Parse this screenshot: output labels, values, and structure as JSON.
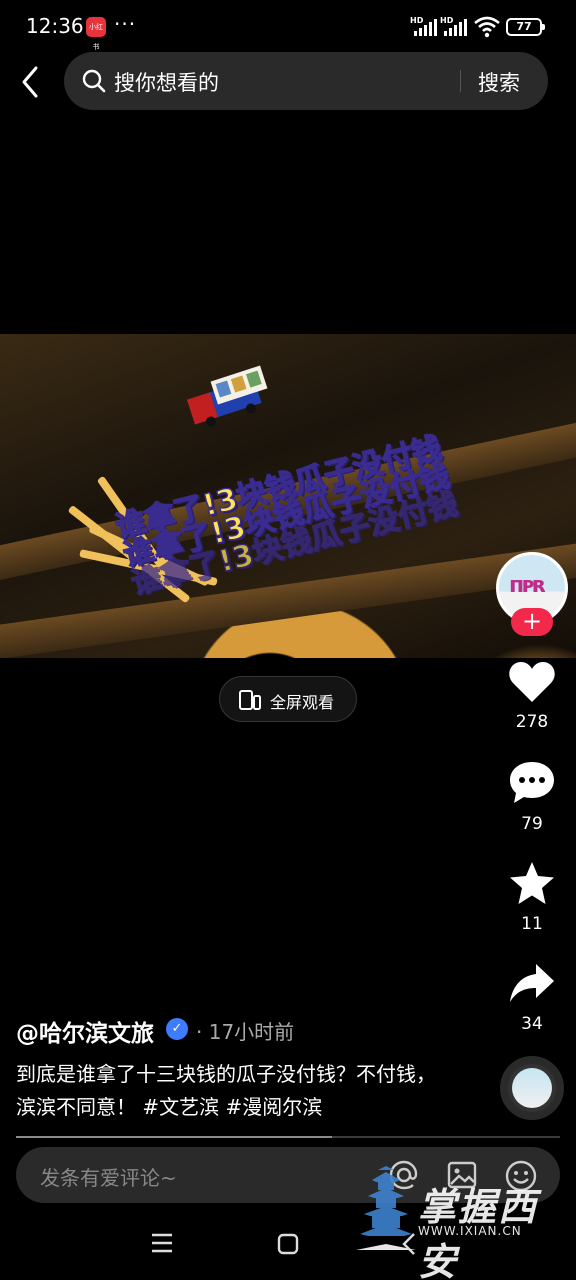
{
  "status_bar": {
    "time": "12:36",
    "app_badge": "小红书",
    "dots": "···",
    "signal1_label": "HD",
    "signal2_label": "HD",
    "battery": "77"
  },
  "search": {
    "placeholder": "搜你想看的",
    "button_label": "搜索"
  },
  "video": {
    "title_lines": [
      "谁拿了!3块钱瓜子没付钱",
      "谁拿了!3块钱瓜子没付钱",
      "谁拿了!3块钱瓜子没付钱"
    ],
    "fullscreen_label": "全屏观看"
  },
  "actions": {
    "like_count": "278",
    "comment_count": "79",
    "favorite_count": "11",
    "share_count": "34"
  },
  "post": {
    "author": "@哈尔滨文旅",
    "time": "· 17小时前",
    "caption": "到底是谁拿了十三块钱的瓜子没付钱？不付钱，滨滨不同意！ #文艺滨 #漫阅尔滨",
    "progress": 0.58
  },
  "comment": {
    "placeholder": "发条有爱评论~"
  },
  "watermark": {
    "text": "掌握西安",
    "url": "WWW.IXIAN.CN"
  },
  "colors": {
    "accent": "#f2294b",
    "verified": "#3d7bff",
    "title_text": "#ffe15a"
  }
}
